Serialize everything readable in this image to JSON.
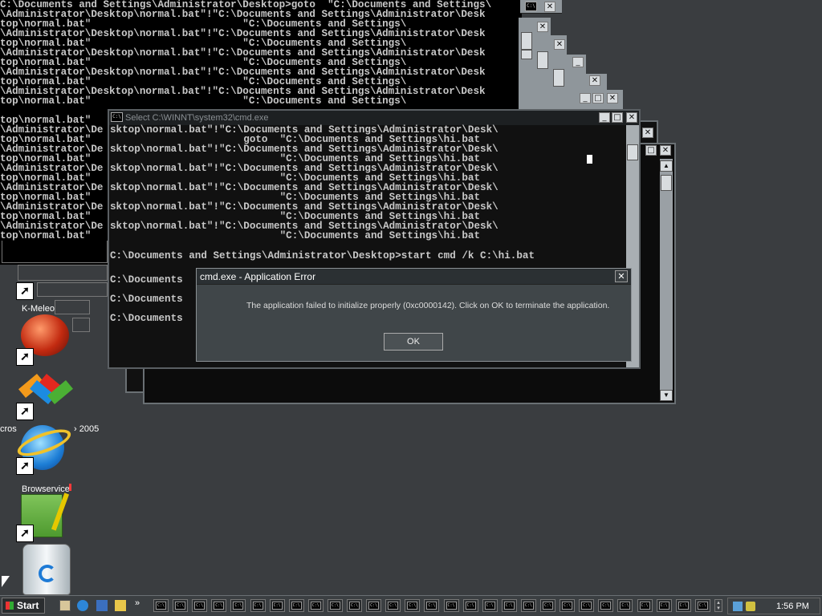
{
  "background_console": {
    "lines": [
      "C:\\Documents and Settings\\Administrator\\Desktop>goto  \"C:\\Documents and Settings\\",
      "\\Administrator\\Desktop\\normal.bat\"!\"C:\\Documents and Settings\\Administrator\\Desk",
      "top\\normal.bat\"                         \"C:\\Documents and Settings\\",
      "\\Administrator\\Desktop\\normal.bat\"!\"C:\\Documents and Settings\\Administrator\\Desk",
      "top\\normal.bat\"                         \"C:\\Documents and Settings\\",
      "\\Administrator\\Desktop\\normal.bat\"!\"C:\\Documents and Settings\\Administrator\\Desk",
      "top\\normal.bat\"                         \"C:\\Documents and Settings\\",
      "\\Administrator\\Desktop\\normal.bat\"!\"C:\\Documents and Settings\\Administrator\\Desk",
      "top\\normal.bat\"                         \"C:\\Documents and Settings\\",
      "\\Administrator\\Desktop\\normal.bat\"!\"C:\\Documents and Settings\\Administrator\\Desk",
      "top\\normal.bat\"                         \"C:\\Documents and Settings\\"
    ],
    "left_fragments": [
      "top\\normal.bat\"",
      "\\Administrator\\De",
      "top\\normal.bat\"",
      "\\Administrator\\De",
      "top\\normal.bat\"",
      "\\Administrator\\De",
      "top\\normal.bat\"",
      "\\Administrator\\De",
      "top\\normal.bat\"",
      "\\Administrator\\De",
      "top\\normal.bat\"",
      "\\Administrator\\De",
      "top\\normal.bat\""
    ]
  },
  "front_window": {
    "title": "Select C:\\WINNT\\system32\\cmd.exe",
    "icon_text": "C:\\",
    "lines": [
      "sktop\\normal.bat\"!\"C:\\Documents and Settings\\Administrator\\Desk\\",
      "                      goto  \"C:\\Documents and Settings\\hi.bat",
      "sktop\\normal.bat\"!\"C:\\Documents and Settings\\Administrator\\Desk\\",
      "                            \"C:\\Documents and Settings\\hi.bat",
      "sktop\\normal.bat\"!\"C:\\Documents and Settings\\Administrator\\Desk\\",
      "                            \"C:\\Documents and Settings\\hi.bat",
      "sktop\\normal.bat\"!\"C:\\Documents and Settings\\Administrator\\Desk\\",
      "                            \"C:\\Documents and Settings\\hi.bat",
      "sktop\\normal.bat\"!\"C:\\Documents and Settings\\Administrator\\Desk\\",
      "                            \"C:\\Documents and Settings\\hi.bat",
      "sktop\\normal.bat\"!\"C:\\Documents and Settings\\Administrator\\Desk\\",
      "                            \"C:\\Documents and Settings\\hi.bat"
    ],
    "command_line": "C:\\Documents and Settings\\Administrator\\Desktop>start cmd /k C:\\hi.bat",
    "prompt_lines": [
      "C:\\Documents ",
      "C:\\Documents ",
      "C:\\Documents "
    ]
  },
  "error_dialog": {
    "title": "cmd.exe - Application Error",
    "message": "The application failed to initialize properly (0xc0000142). Click on OK to terminate the application.",
    "ok_label": "OK"
  },
  "desktop_icons": [
    {
      "name": "K-Meleo",
      "label": "K-Meleo"
    },
    {
      "name": "visual-studio-2005",
      "label_left": "cros",
      "label_right": "2005"
    },
    {
      "name": "browservice",
      "label": "Browservice"
    }
  ],
  "taskbar": {
    "start_label": "Start",
    "clock": "1:56 PM",
    "task_icon_text": "C:\\",
    "overflow_glyph": "»"
  },
  "window_buttons": {
    "minimize": "_",
    "maximize": "□",
    "close": "✕"
  },
  "colors": {
    "console_text": "#c8c8c8",
    "desktop": "#3a3d40",
    "dialog_bg": "#404649",
    "dialog_title": "#2b3033"
  }
}
